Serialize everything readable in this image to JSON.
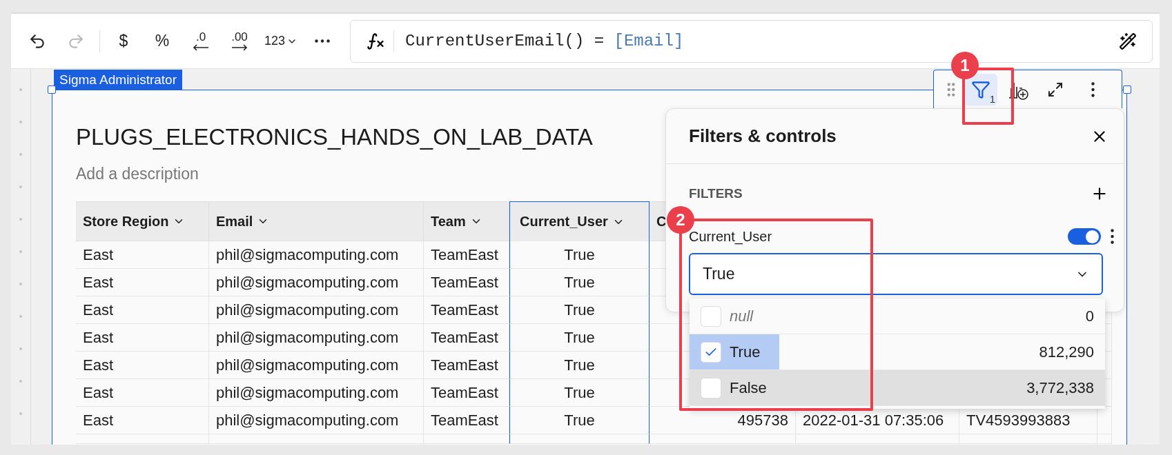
{
  "toolbar": {
    "buttons": [
      {
        "kind": "undo",
        "disabled": false
      },
      {
        "kind": "redo",
        "disabled": true
      },
      {
        "kind": "separator"
      },
      {
        "kind": "text",
        "label": "$"
      },
      {
        "kind": "text",
        "label": "%"
      },
      {
        "kind": "decimal_less",
        "label": ".0"
      },
      {
        "kind": "decimal_more",
        "label": ".00"
      },
      {
        "kind": "format",
        "label": "123"
      },
      {
        "kind": "more"
      }
    ]
  },
  "formula": {
    "text": "CurrentUserEmail() = ",
    "reference": "[Email]"
  },
  "element": {
    "tag": "Sigma Administrator",
    "title": "PLUGS_ELECTRONICS_HANDS_ON_LAB_DATA",
    "description_placeholder": "Add a description"
  },
  "card_toolbar": {
    "filter_active": true,
    "filter_count": "1"
  },
  "table": {
    "columns": [
      {
        "label": "Store Region",
        "selected": false
      },
      {
        "label": "Email",
        "selected": false
      },
      {
        "label": "Team",
        "selected": false
      },
      {
        "label": "Current_User",
        "selected": true
      },
      {
        "label": "C",
        "selected": false
      }
    ],
    "rows": [
      {
        "cells": [
          "East",
          "phil@sigmacomputing.com",
          "TeamEast",
          "True"
        ]
      },
      {
        "cells": [
          "East",
          "phil@sigmacomputing.com",
          "TeamEast",
          "True"
        ]
      },
      {
        "cells": [
          "East",
          "phil@sigmacomputing.com",
          "TeamEast",
          "True"
        ]
      },
      {
        "cells": [
          "East",
          "phil@sigmacomputing.com",
          "TeamEast",
          "True"
        ]
      },
      {
        "cells": [
          "East",
          "phil@sigmacomputing.com",
          "TeamEast",
          "True"
        ]
      },
      {
        "cells": [
          "East",
          "phil@sigmacomputing.com",
          "TeamEast",
          "True"
        ]
      },
      {
        "cells": [
          "East",
          "phil@sigmacomputing.com",
          "TeamEast",
          "True",
          "495738",
          "2022-01-31 07:35:06",
          "TV4593993883"
        ]
      }
    ]
  },
  "filters_panel": {
    "title": "Filters & controls",
    "section": "FILTERS",
    "filters": [
      {
        "label": "Current_User",
        "on": true,
        "value": "True",
        "expanded": true,
        "options": [
          {
            "kind": "null",
            "label": "null",
            "count": "0",
            "checked": false,
            "highlighted": false
          },
          {
            "kind": "value",
            "label": "True",
            "count": "812,290",
            "checked": true,
            "highlighted": false
          },
          {
            "kind": "value",
            "label": "False",
            "count": "3,772,338",
            "checked": false,
            "highlighted": true
          }
        ]
      }
    ]
  },
  "annotations": [
    {
      "label": "1"
    },
    {
      "label": "2"
    }
  ]
}
